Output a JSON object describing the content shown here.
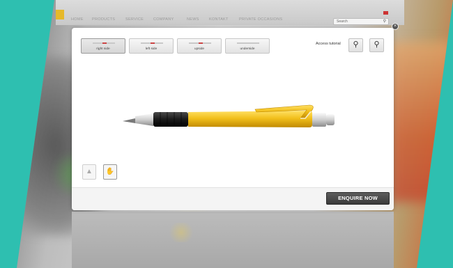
{
  "nav": {
    "items": [
      {
        "label": "HOME"
      },
      {
        "label": "PRODUCTS"
      },
      {
        "label": "SERVICE"
      },
      {
        "label": "COMPANY"
      },
      {
        "label": "NEWS"
      },
      {
        "label": "KONTAKT"
      },
      {
        "label": "PRIVATE OCCASIONS"
      }
    ],
    "search_placeholder": "Search"
  },
  "modal": {
    "view_tabs": [
      {
        "label": "right side",
        "active": true
      },
      {
        "label": "left side",
        "active": false
      },
      {
        "label": "upside",
        "active": false
      },
      {
        "label": "underside",
        "active": false
      }
    ],
    "tutorial_label": "Access tutorial",
    "enquire_label": "ENQUIRE NOW",
    "close_glyph": "×"
  },
  "icons": {
    "zoom_in": "zoom-in-icon",
    "zoom_out": "zoom-out-icon",
    "rotate": "rotate-icon",
    "hand": "hand-icon"
  },
  "colors": {
    "accent_frame": "#2ebfb0",
    "pen_body": "#f2c01c",
    "pen_grip": "#1a1a1a",
    "button_dark": "#3a3a3a"
  }
}
